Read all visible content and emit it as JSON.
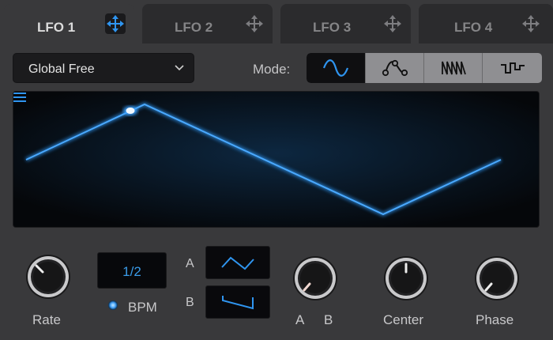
{
  "tabs": [
    {
      "label": "LFO 1",
      "active": true
    },
    {
      "label": "LFO 2",
      "active": false
    },
    {
      "label": "LFO 3",
      "active": false
    },
    {
      "label": "LFO 4",
      "active": false
    }
  ],
  "preset": {
    "label": "Global Free"
  },
  "mode": {
    "label": "Mode:",
    "options": [
      "sine-wave-icon",
      "curve-nodes-icon",
      "sawtooth-steps-icon",
      "step-sequencer-icon"
    ],
    "selected": 0
  },
  "controls": {
    "rate_label": "Rate",
    "rate_value": "1/2",
    "bpm_label": "BPM",
    "bpm_on": true,
    "wave_a_letter": "A",
    "wave_b_letter": "B",
    "ab_label_a": "A",
    "ab_label_b": "B",
    "center_label": "Center",
    "phase_label": "Phase"
  },
  "colors": {
    "accent": "#2f95f0",
    "panel": "#39393b",
    "display_bg": "#06080c"
  }
}
